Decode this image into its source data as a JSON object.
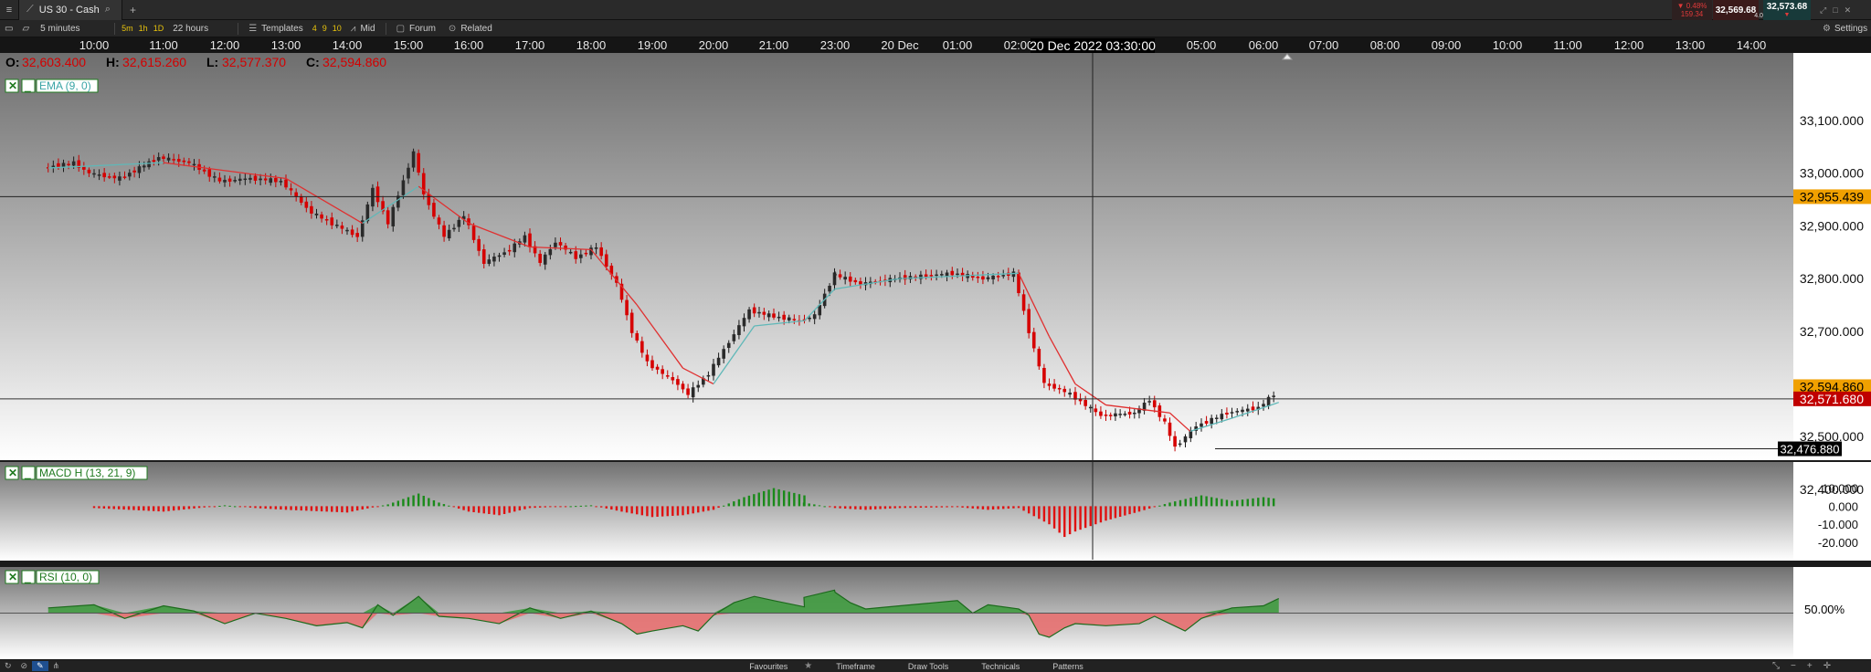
{
  "window": {
    "menu_icon": "menu-icon",
    "tab_title": "US 30 - Cash",
    "new_tab_label": "+",
    "quote": {
      "change_pct": "▼ 0.48%",
      "change_pts": "159.34",
      "bid": "32,569.68",
      "ask": "32,573.68",
      "spread": "4.00",
      "down_color": "#e03a3a"
    },
    "settings_label": "Settings"
  },
  "toolbar": {
    "interval_label": "5 minutes",
    "quick_intervals": [
      "5m",
      "1h",
      "1D"
    ],
    "range_label": "22 hours",
    "templates_label": "Templates",
    "template_slots": [
      "4",
      "9",
      "10"
    ],
    "price_mode_label": "Mid",
    "forum_label": "Forum",
    "related_label": "Related"
  },
  "time_axis": {
    "labels": [
      "10:00",
      "11:00",
      "12:00",
      "13:00",
      "14:00",
      "15:00",
      "16:00",
      "17:00",
      "18:00",
      "19:00",
      "20:00",
      "21:00",
      "23:00",
      "20 Dec",
      "01:00",
      "02:00",
      "05:00",
      "06:00",
      "07:00",
      "08:00",
      "09:00",
      "10:00",
      "11:00",
      "12:00",
      "13:00",
      "14:00"
    ],
    "crosshair_time": "20 Dec 2022 03:30:00"
  },
  "ohlc": {
    "o_label": "O:",
    "o": "32,603.400",
    "h_label": "H:",
    "h": "32,615.260",
    "l_label": "L:",
    "l": "32,577.370",
    "c_label": "C:",
    "c": "32,594.860",
    "value_color": "#d40000"
  },
  "indicators": {
    "ema_label": "EMA (9, 0)",
    "macd_label": "MACD H (13, 21, 9)",
    "rsi_label": "RSI (10, 0)",
    "close_icon": "close-icon",
    "minimize_icon": "minimize-icon"
  },
  "price_axis": {
    "ticks": [
      "33,100.000",
      "33,000.000",
      "32,900.000",
      "32,800.000",
      "32,700.000",
      "32,600.000",
      "32,500.000",
      "32,400.000"
    ],
    "crosshair_price": "32,955.439",
    "last_close": "32,594.860",
    "current_price": "32,571.680",
    "low_marker": "32,476.880",
    "orange": "#f0a000",
    "red": "#c00000"
  },
  "macd_axis": {
    "ticks": [
      "10.000",
      "0.000",
      "-10.000",
      "-20.000"
    ]
  },
  "rsi_axis": {
    "level": "50.00%"
  },
  "bottom_bar": {
    "favourites_label": "Favourites",
    "timeframe_label": "Timeframe",
    "draw_tools_label": "Draw Tools",
    "technicals_label": "Technicals",
    "patterns_label": "Patterns"
  },
  "chart_data": [
    {
      "type": "candlestick",
      "title": "US 30 - Cash",
      "interval": "5 minutes",
      "x_range": [
        "19 Dec 09:15",
        "20 Dec 14:40"
      ],
      "ylim": [
        32380,
        33140
      ],
      "grid": false,
      "close_path": [
        {
          "t": "09:15",
          "v": 33010
        },
        {
          "t": "09:45",
          "v": 33020
        },
        {
          "t": "10:00",
          "v": 33000
        },
        {
          "t": "10:30",
          "v": 32990
        },
        {
          "t": "11:00",
          "v": 33030
        },
        {
          "t": "11:30",
          "v": 33020
        },
        {
          "t": "12:00",
          "v": 32985
        },
        {
          "t": "12:30",
          "v": 32990
        },
        {
          "t": "13:00",
          "v": 32985
        },
        {
          "t": "13:30",
          "v": 32925
        },
        {
          "t": "14:00",
          "v": 32895
        },
        {
          "t": "14:15",
          "v": 32880
        },
        {
          "t": "14:30",
          "v": 32970
        },
        {
          "t": "14:45",
          "v": 32905
        },
        {
          "t": "15:10",
          "v": 33040
        },
        {
          "t": "15:20",
          "v": 32960
        },
        {
          "t": "15:40",
          "v": 32880
        },
        {
          "t": "16:00",
          "v": 32920
        },
        {
          "t": "16:20",
          "v": 32830
        },
        {
          "t": "16:45",
          "v": 32855
        },
        {
          "t": "17:00",
          "v": 32880
        },
        {
          "t": "17:15",
          "v": 32830
        },
        {
          "t": "17:30",
          "v": 32870
        },
        {
          "t": "17:50",
          "v": 32840
        },
        {
          "t": "18:10",
          "v": 32860
        },
        {
          "t": "18:30",
          "v": 32790
        },
        {
          "t": "18:45",
          "v": 32700
        },
        {
          "t": "19:00",
          "v": 32640
        },
        {
          "t": "19:30",
          "v": 32600
        },
        {
          "t": "19:40",
          "v": 32580
        },
        {
          "t": "20:00",
          "v": 32620
        },
        {
          "t": "20:20",
          "v": 32680
        },
        {
          "t": "20:40",
          "v": 32740
        },
        {
          "t": "21:00",
          "v": 32730
        },
        {
          "t": "21:30",
          "v": 32720
        },
        {
          "t": "21:45",
          "v": 32730
        },
        {
          "t": "22:30",
          "v": 32790
        },
        {
          "t": "23:00",
          "v": 32810
        },
        {
          "t": "23:30",
          "v": 32790
        },
        {
          "t": "20 Dec",
          "v": 32800
        },
        {
          "t": "01:00",
          "v": 32810
        },
        {
          "t": "01:30",
          "v": 32800
        },
        {
          "t": "02:00",
          "v": 32810
        },
        {
          "t": "02:15",
          "v": 32700
        },
        {
          "t": "02:30",
          "v": 32600
        },
        {
          "t": "02:45",
          "v": 32590
        },
        {
          "t": "03:00",
          "v": 32580
        },
        {
          "t": "03:30",
          "v": 32540
        },
        {
          "t": "04:00",
          "v": 32545
        },
        {
          "t": "04:15",
          "v": 32570
        },
        {
          "t": "04:30",
          "v": 32525
        },
        {
          "t": "04:40",
          "v": 32480
        },
        {
          "t": "05:00",
          "v": 32520
        },
        {
          "t": "05:30",
          "v": 32545
        },
        {
          "t": "06:00",
          "v": 32555
        },
        {
          "t": "06:15",
          "v": 32580
        }
      ],
      "ema_9": [
        {
          "t": "09:15",
          "v": 33010
        },
        {
          "t": "11:00",
          "v": 33020
        },
        {
          "t": "13:00",
          "v": 32990
        },
        {
          "t": "14:15",
          "v": 32905
        },
        {
          "t": "15:10",
          "v": 32975
        },
        {
          "t": "16:00",
          "v": 32905
        },
        {
          "t": "17:00",
          "v": 32860
        },
        {
          "t": "18:00",
          "v": 32855
        },
        {
          "t": "18:45",
          "v": 32750
        },
        {
          "t": "19:30",
          "v": 32630
        },
        {
          "t": "20:00",
          "v": 32600
        },
        {
          "t": "20:40",
          "v": 32710
        },
        {
          "t": "21:30",
          "v": 32720
        },
        {
          "t": "22:30",
          "v": 32780
        },
        {
          "t": "20 Dec",
          "v": 32800
        },
        {
          "t": "02:00",
          "v": 32810
        },
        {
          "t": "02:30",
          "v": 32690
        },
        {
          "t": "03:00",
          "v": 32600
        },
        {
          "t": "03:30",
          "v": 32560
        },
        {
          "t": "04:30",
          "v": 32545
        },
        {
          "t": "04:50",
          "v": 32510
        },
        {
          "t": "05:30",
          "v": 32535
        },
        {
          "t": "06:15",
          "v": 32565
        }
      ]
    },
    {
      "type": "bar",
      "title": "MACD H (13, 21, 9)",
      "ylim": [
        -22,
        13
      ],
      "points": [
        {
          "t": "10:00",
          "v": -1
        },
        {
          "t": "11:00",
          "v": -3
        },
        {
          "t": "12:00",
          "v": 0.5
        },
        {
          "t": "12:30",
          "v": -1
        },
        {
          "t": "13:00",
          "v": -2
        },
        {
          "t": "14:00",
          "v": -3.5
        },
        {
          "t": "14:40",
          "v": 1
        },
        {
          "t": "15:10",
          "v": 7
        },
        {
          "t": "15:30",
          "v": 2
        },
        {
          "t": "16:00",
          "v": -3
        },
        {
          "t": "16:30",
          "v": -5
        },
        {
          "t": "17:00",
          "v": -1
        },
        {
          "t": "18:00",
          "v": 0.5
        },
        {
          "t": "18:30",
          "v": -3
        },
        {
          "t": "19:00",
          "v": -6
        },
        {
          "t": "19:30",
          "v": -5
        },
        {
          "t": "20:00",
          "v": -2
        },
        {
          "t": "20:30",
          "v": 5
        },
        {
          "t": "21:00",
          "v": 10
        },
        {
          "t": "21:30",
          "v": 6
        },
        {
          "t": "22:00",
          "v": 2
        },
        {
          "t": "23:00",
          "v": -1
        },
        {
          "t": "23:30",
          "v": -2
        },
        {
          "t": "20 Dec",
          "v": -1
        },
        {
          "t": "01:00",
          "v": -0.5
        },
        {
          "t": "01:30",
          "v": -2
        },
        {
          "t": "02:00",
          "v": -1
        },
        {
          "t": "02:30",
          "v": -10
        },
        {
          "t": "02:45",
          "v": -17
        },
        {
          "t": "03:00",
          "v": -14
        },
        {
          "t": "03:30",
          "v": -8
        },
        {
          "t": "04:00",
          "v": -3
        },
        {
          "t": "04:30",
          "v": 2
        },
        {
          "t": "05:00",
          "v": 6
        },
        {
          "t": "05:30",
          "v": 3
        },
        {
          "t": "06:00",
          "v": 5
        },
        {
          "t": "06:15",
          "v": 4
        }
      ]
    },
    {
      "type": "area",
      "title": "RSI (10, 0)",
      "level": 50,
      "ylim": [
        20,
        80
      ],
      "points": [
        {
          "t": "09:15",
          "v": 55
        },
        {
          "t": "10:00",
          "v": 58
        },
        {
          "t": "10:30",
          "v": 45
        },
        {
          "t": "11:00",
          "v": 57
        },
        {
          "t": "11:30",
          "v": 52
        },
        {
          "t": "12:00",
          "v": 40
        },
        {
          "t": "12:30",
          "v": 50
        },
        {
          "t": "13:00",
          "v": 45
        },
        {
          "t": "13:30",
          "v": 38
        },
        {
          "t": "14:00",
          "v": 41
        },
        {
          "t": "14:15",
          "v": 36
        },
        {
          "t": "14:30",
          "v": 58
        },
        {
          "t": "14:45",
          "v": 48
        },
        {
          "t": "15:10",
          "v": 66
        },
        {
          "t": "15:30",
          "v": 47
        },
        {
          "t": "16:00",
          "v": 45
        },
        {
          "t": "16:30",
          "v": 40
        },
        {
          "t": "17:00",
          "v": 55
        },
        {
          "t": "17:30",
          "v": 45
        },
        {
          "t": "18:00",
          "v": 52
        },
        {
          "t": "18:30",
          "v": 40
        },
        {
          "t": "18:45",
          "v": 30
        },
        {
          "t": "19:00",
          "v": 33
        },
        {
          "t": "19:30",
          "v": 38
        },
        {
          "t": "19:45",
          "v": 33
        },
        {
          "t": "20:00",
          "v": 48
        },
        {
          "t": "20:20",
          "v": 60
        },
        {
          "t": "20:40",
          "v": 66
        },
        {
          "t": "21:00",
          "v": 62
        },
        {
          "t": "21:30",
          "v": 56
        },
        {
          "t": "22:00",
          "v": 65
        },
        {
          "t": "22:30",
          "v": 72
        },
        {
          "t": "23:00",
          "v": 70
        },
        {
          "t": "23:15",
          "v": 60
        },
        {
          "t": "23:30",
          "v": 54
        },
        {
          "t": "20 Dec",
          "v": 57
        },
        {
          "t": "01:00",
          "v": 62
        },
        {
          "t": "01:15",
          "v": 50
        },
        {
          "t": "01:30",
          "v": 58
        },
        {
          "t": "02:00",
          "v": 54
        },
        {
          "t": "02:10",
          "v": 48
        },
        {
          "t": "02:20",
          "v": 30
        },
        {
          "t": "02:30",
          "v": 27
        },
        {
          "t": "02:45",
          "v": 36
        },
        {
          "t": "03:00",
          "v": 40
        },
        {
          "t": "03:30",
          "v": 38
        },
        {
          "t": "04:00",
          "v": 40
        },
        {
          "t": "04:15",
          "v": 47
        },
        {
          "t": "04:30",
          "v": 40
        },
        {
          "t": "04:45",
          "v": 33
        },
        {
          "t": "05:00",
          "v": 45
        },
        {
          "t": "05:30",
          "v": 55
        },
        {
          "t": "06:00",
          "v": 57
        },
        {
          "t": "06:15",
          "v": 64
        }
      ]
    }
  ]
}
